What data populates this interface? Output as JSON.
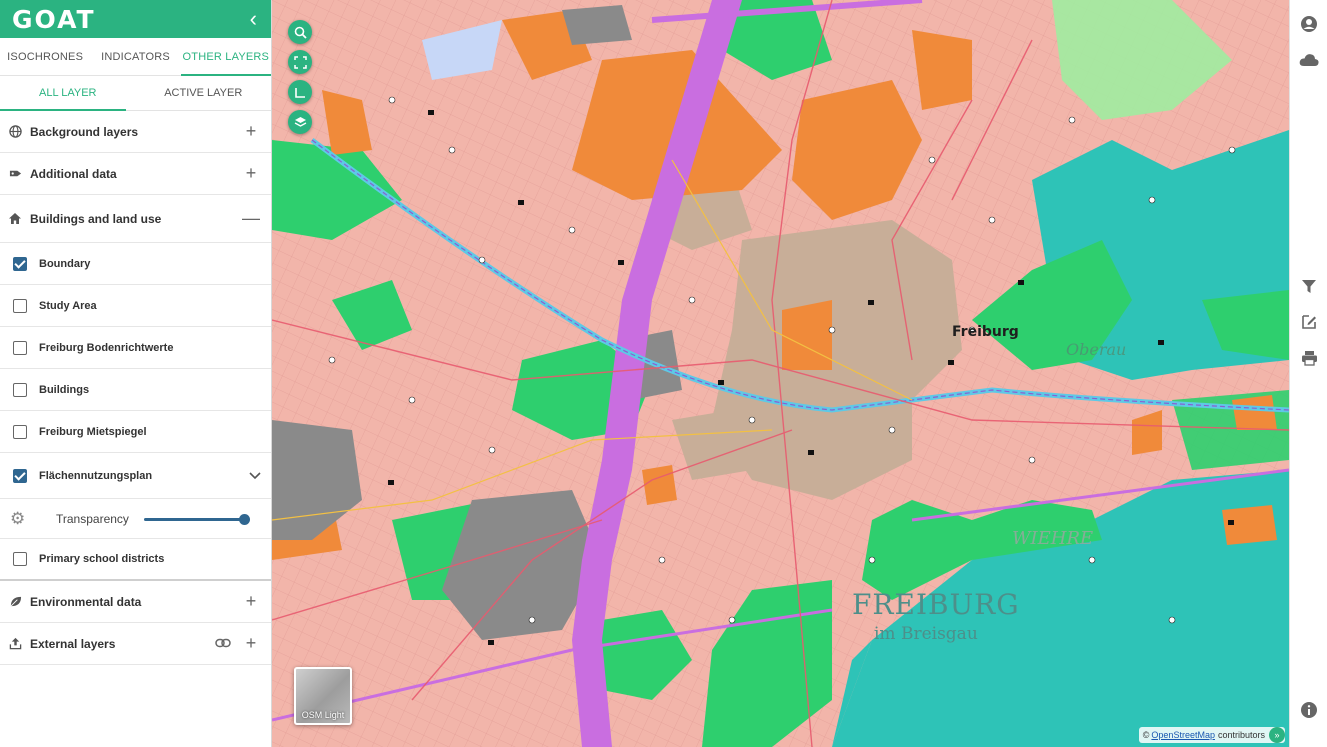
{
  "app": {
    "logo": "GOAT",
    "collapse": "‹"
  },
  "tabs": [
    {
      "label": "ISOCHRONES"
    },
    {
      "label": "INDICATORS"
    },
    {
      "label": "OTHER LAYERS"
    }
  ],
  "subtabs": [
    {
      "label": "ALL LAYER"
    },
    {
      "label": "ACTIVE LAYER"
    }
  ],
  "groups": {
    "background": {
      "label": "Background layers",
      "icon": "globe-icon",
      "action": "+"
    },
    "additional": {
      "label": "Additional data",
      "icon": "tag-icon",
      "action": "+"
    },
    "buildings": {
      "label": "Buildings and land use",
      "icon": "home-icon",
      "action": "—"
    },
    "environmental": {
      "label": "Environmental data",
      "icon": "leaf-icon",
      "action": "+"
    },
    "external": {
      "label": "External layers",
      "icon": "upload-icon",
      "action": "+"
    }
  },
  "layers": [
    {
      "label": "Boundary",
      "checked": true
    },
    {
      "label": "Study Area",
      "checked": false
    },
    {
      "label": "Freiburg Bodenrichtwerte",
      "checked": false
    },
    {
      "label": "Buildings",
      "checked": false
    },
    {
      "label": "Freiburg Mietspiegel",
      "checked": false
    },
    {
      "label": "Flächennutzungsplan",
      "checked": true,
      "expanded": true
    },
    {
      "label": "Primary school districts",
      "checked": false
    }
  ],
  "transparency": {
    "label": "Transparency",
    "value": 1.0
  },
  "map": {
    "place_labels": {
      "freiburg": "Freiburg",
      "freiburg_big": "FREIBURG",
      "breisgau": "im Breisgau",
      "wiehre": "WIEHRE",
      "oberau": "Oberau"
    },
    "basemap_label": "OSM Light",
    "attribution": {
      "prefix": "©",
      "link": "OpenStreetMap",
      "suffix": "contributors",
      "expand": "»"
    }
  },
  "colors": {
    "brand": "#2bb381",
    "residential": "#f2b5aa",
    "commercial": "#f08a3a",
    "green": "#2ecf6e",
    "forest": "#2ec3b7",
    "rail": "#c96ee0",
    "industrial": "#8a8a8a",
    "oldtown": "#c8ae98"
  }
}
